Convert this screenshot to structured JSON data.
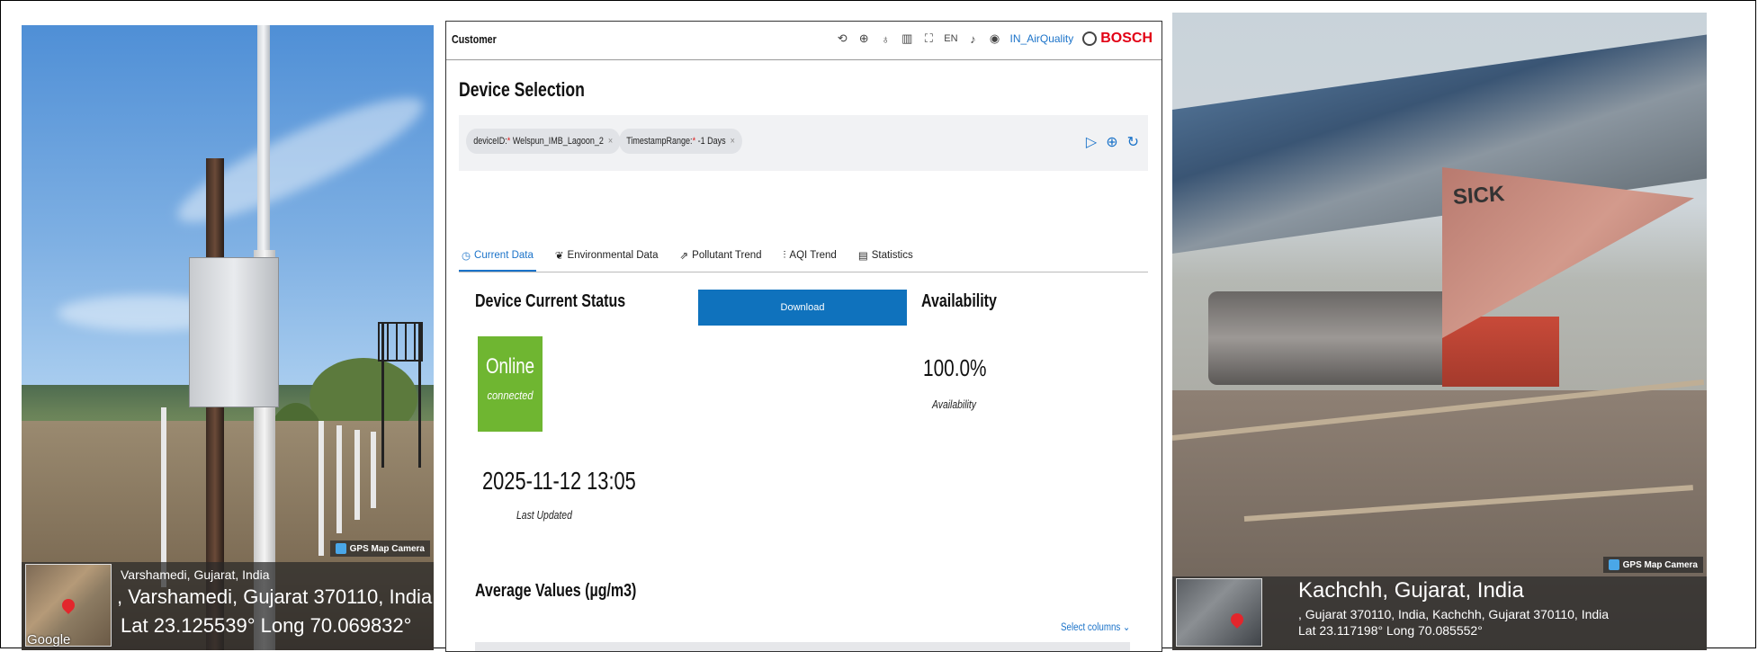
{
  "left_photo": {
    "gps_badge": "GPS Map Camera",
    "place": "Varshamedi, Gujarat, India",
    "address": ", Varshamedi, Gujarat 370110, India",
    "coords": "Lat 23.125539° Long 70.069832°",
    "map_brand": "Google"
  },
  "dashboard": {
    "app_title": "Customer",
    "language": "EN",
    "app_link": "IN_AirQuality",
    "brand": "BOSCH",
    "section_title": "Device Selection",
    "filters": [
      {
        "label": "deviceID:",
        "value": " Welspun_IMB_Lagoon_2"
      },
      {
        "label": "TimestampRange:",
        "value": " -1 Days"
      }
    ],
    "tabs": [
      "Current Data",
      "Environmental Data",
      "Pollutant Trend",
      "AQI Trend",
      "Statistics"
    ],
    "status_title": "Device Current Status",
    "download_label": "Download",
    "availability_title": "Availability",
    "status_value": "Online",
    "status_sub": "connected",
    "availability_value": "100.0%",
    "availability_label": "Availability",
    "last_updated_value": "2025-11-12 13:05",
    "last_updated_label": "Last Updated",
    "avg_title": "Average Values (µg/m3)",
    "select_columns": "Select columns",
    "colors": {
      "accent": "#0f72bd",
      "online": "#6fb631",
      "brand": "#e20015"
    }
  },
  "right_photo": {
    "gps_badge": "GPS Map Camera",
    "place": "Kachchh, Gujarat, India",
    "address": ", Gujarat 370110, India, Kachchh, Gujarat 370110, India",
    "coords": "Lat 23.117198° Long 70.085552°",
    "sign_text": "SICK"
  }
}
